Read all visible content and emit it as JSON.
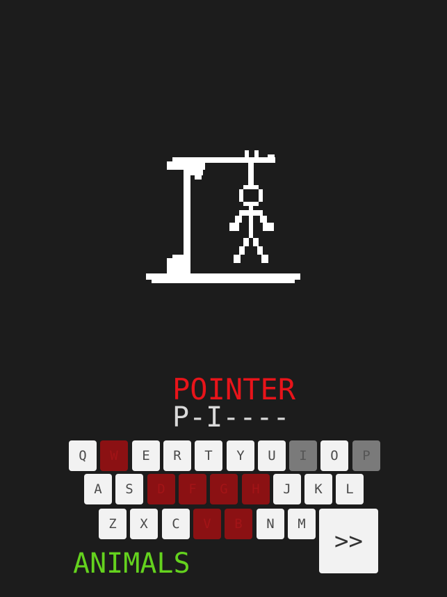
{
  "game": {
    "answer": "POINTER",
    "guess_display": "P-I----",
    "category": "ANIMALS",
    "next_label": ">>"
  },
  "keyboard": {
    "rows": [
      [
        {
          "letter": "Q",
          "state": "unused"
        },
        {
          "letter": "W",
          "state": "wrong"
        },
        {
          "letter": "E",
          "state": "unused"
        },
        {
          "letter": "R",
          "state": "unused"
        },
        {
          "letter": "T",
          "state": "unused"
        },
        {
          "letter": "Y",
          "state": "unused"
        },
        {
          "letter": "U",
          "state": "unused"
        },
        {
          "letter": "I",
          "state": "correct"
        },
        {
          "letter": "O",
          "state": "unused"
        },
        {
          "letter": "P",
          "state": "correct"
        }
      ],
      [
        {
          "letter": "A",
          "state": "unused"
        },
        {
          "letter": "S",
          "state": "unused"
        },
        {
          "letter": "D",
          "state": "wrong"
        },
        {
          "letter": "F",
          "state": "wrong"
        },
        {
          "letter": "G",
          "state": "wrong"
        },
        {
          "letter": "H",
          "state": "wrong"
        },
        {
          "letter": "J",
          "state": "unused"
        },
        {
          "letter": "K",
          "state": "unused"
        },
        {
          "letter": "L",
          "state": "unused"
        }
      ],
      [
        {
          "letter": "Z",
          "state": "unused"
        },
        {
          "letter": "X",
          "state": "unused"
        },
        {
          "letter": "C",
          "state": "unused"
        },
        {
          "letter": "V",
          "state": "wrong"
        },
        {
          "letter": "B",
          "state": "wrong"
        },
        {
          "letter": "N",
          "state": "unused"
        },
        {
          "letter": "M",
          "state": "unused"
        }
      ]
    ]
  },
  "colors": {
    "background": "#1c1c1c",
    "answer": "#e8141a",
    "category": "#64d21e",
    "key": "#f2f2f2",
    "key_wrong": "#8b1113",
    "key_correct": "#7a7a7a"
  }
}
